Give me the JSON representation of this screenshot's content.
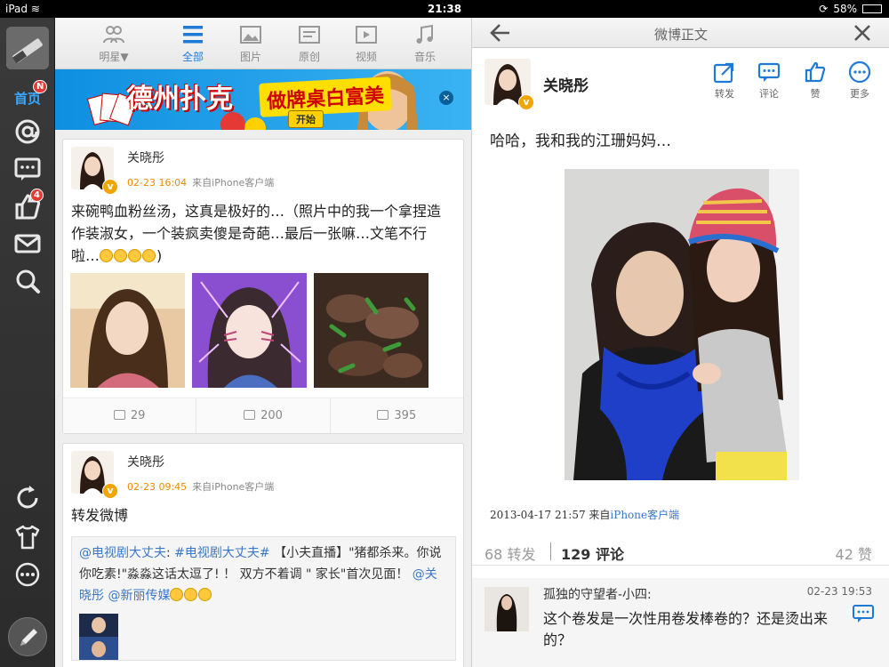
{
  "status": {
    "device": "iPad",
    "time": "21:38",
    "battery": "58%"
  },
  "sidebar": {
    "home_label": "首页",
    "home_badge": "N",
    "share_badge": "4"
  },
  "tabs": [
    {
      "label": "明星▼"
    },
    {
      "label": "全部"
    },
    {
      "label": "图片"
    },
    {
      "label": "原创"
    },
    {
      "label": "视频"
    },
    {
      "label": "音乐"
    }
  ],
  "ad": {
    "title": "德州扑克",
    "subtitle": "做牌桌白富美",
    "button": "开始"
  },
  "feed": [
    {
      "user": "关晓彤",
      "time": "02-23 16:04",
      "source": "来自iPhone客户端",
      "text": "来碗鸭血粉丝汤，这真是极好的…（照片中的我一个拿捏造作装淑女，一个装疯卖傻是奇葩…最后一张嘛…文笔不行啦…",
      "reposts": "29",
      "comments": "200",
      "likes": "395"
    },
    {
      "user": "关晓彤",
      "time": "02-23 09:45",
      "source": "来自iPhone客户端",
      "text": "转发微博",
      "repost_user": "@电视剧大丈夫",
      "repost_tag": "#电视剧大丈夫#",
      "repost_body": " 【小夫直播】\"猪都杀来。你说你吃素!\"淼淼这话太逗了! ！  双方不着调 \" 家长\"首次见面！",
      "repost_mention1": "@关晓彤",
      "repost_mention2": "@新丽传媒"
    }
  ],
  "detail": {
    "header_title": "微博正文",
    "user": "关晓彤",
    "actions": [
      {
        "label": "转发"
      },
      {
        "label": "评论"
      },
      {
        "label": "赞"
      },
      {
        "label": "更多"
      }
    ],
    "text": "哈哈，我和我的江珊妈妈…",
    "time": "2013-04-17 21:57 来自",
    "source": "iPhone客户端",
    "reposts": "68 转发",
    "comments_count": "129",
    "comments_label": " 评论",
    "likes": "42 赞",
    "comment": {
      "user": "孤独的守望者-小四:",
      "time": "02-23 19:53",
      "text": "这个卷发是一次性用卷发棒卷的？还是烫出来的？"
    }
  },
  "colors": {
    "accent": "#1e7ad6",
    "orange": "#f08a00",
    "link": "#3a77c7"
  }
}
